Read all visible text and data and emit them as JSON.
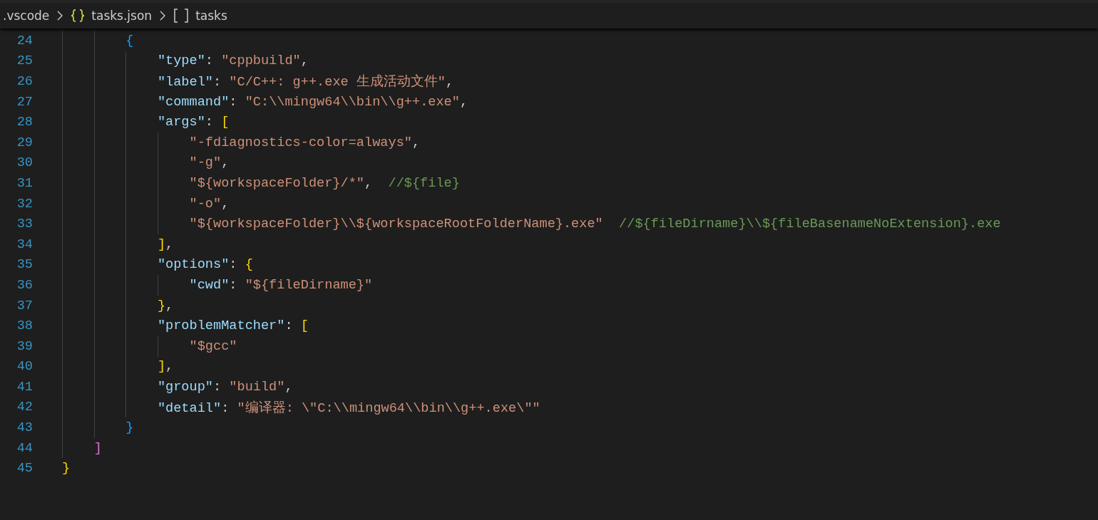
{
  "breadcrumb": [
    {
      "kind": "folder",
      "label": ".vscode"
    },
    {
      "kind": "json-file",
      "label": "tasks.json"
    },
    {
      "kind": "array",
      "label": "tasks"
    }
  ],
  "editor": {
    "lines": [
      {
        "number": "24",
        "tokens": [
          {
            "kind": "bracket_blue",
            "text": "        {"
          }
        ]
      },
      {
        "number": "25",
        "tokens": [
          {
            "kind": "key",
            "text": "            \"type\""
          },
          {
            "kind": "punct",
            "text": ": "
          },
          {
            "kind": "string",
            "text": "\"cppbuild\""
          },
          {
            "kind": "punct",
            "text": ","
          }
        ]
      },
      {
        "number": "26",
        "tokens": [
          {
            "kind": "key",
            "text": "            \"label\""
          },
          {
            "kind": "punct",
            "text": ": "
          },
          {
            "kind": "string",
            "text": "\"C/C++: g++.exe 生成活动文件\""
          },
          {
            "kind": "punct",
            "text": ","
          }
        ]
      },
      {
        "number": "27",
        "tokens": [
          {
            "kind": "key",
            "text": "            \"command\""
          },
          {
            "kind": "punct",
            "text": ": "
          },
          {
            "kind": "string",
            "text": "\"C:\\\\mingw64\\\\bin\\\\g++.exe\""
          },
          {
            "kind": "punct",
            "text": ","
          }
        ]
      },
      {
        "number": "28",
        "tokens": [
          {
            "kind": "key",
            "text": "            \"args\""
          },
          {
            "kind": "punct",
            "text": ": "
          },
          {
            "kind": "bracket_gold",
            "text": "["
          }
        ]
      },
      {
        "number": "29",
        "tokens": [
          {
            "kind": "string",
            "text": "                \"-fdiagnostics-color=always\""
          },
          {
            "kind": "punct",
            "text": ","
          }
        ]
      },
      {
        "number": "30",
        "tokens": [
          {
            "kind": "string",
            "text": "                \"-g\""
          },
          {
            "kind": "punct",
            "text": ","
          }
        ]
      },
      {
        "number": "31",
        "tokens": [
          {
            "kind": "string",
            "text": "                \"${workspaceFolder}/*\""
          },
          {
            "kind": "punct",
            "text": ",  "
          },
          {
            "kind": "comment",
            "text": "//${file}"
          }
        ]
      },
      {
        "number": "32",
        "tokens": [
          {
            "kind": "string",
            "text": "                \"-o\""
          },
          {
            "kind": "punct",
            "text": ","
          }
        ]
      },
      {
        "number": "33",
        "tokens": [
          {
            "kind": "string",
            "text": "                \"${workspaceFolder}\\\\${workspaceRootFolderName}.exe\"  "
          },
          {
            "kind": "comment",
            "text": "//${fileDirname}\\\\${fileBasenameNoExtension}.exe"
          }
        ]
      },
      {
        "number": "34",
        "tokens": [
          {
            "kind": "bracket_gold",
            "text": "            ]"
          },
          {
            "kind": "punct",
            "text": ","
          }
        ]
      },
      {
        "number": "35",
        "tokens": [
          {
            "kind": "key",
            "text": "            \"options\""
          },
          {
            "kind": "punct",
            "text": ": "
          },
          {
            "kind": "bracket_gold",
            "text": "{"
          }
        ]
      },
      {
        "number": "36",
        "tokens": [
          {
            "kind": "key",
            "text": "                \"cwd\""
          },
          {
            "kind": "punct",
            "text": ": "
          },
          {
            "kind": "string",
            "text": "\"${fileDirname}\""
          }
        ]
      },
      {
        "number": "37",
        "tokens": [
          {
            "kind": "bracket_gold",
            "text": "            }"
          },
          {
            "kind": "punct",
            "text": ","
          }
        ]
      },
      {
        "number": "38",
        "tokens": [
          {
            "kind": "key",
            "text": "            \"problemMatcher\""
          },
          {
            "kind": "punct",
            "text": ": "
          },
          {
            "kind": "bracket_gold",
            "text": "["
          }
        ]
      },
      {
        "number": "39",
        "tokens": [
          {
            "kind": "string",
            "text": "                \"$gcc\""
          }
        ]
      },
      {
        "number": "40",
        "tokens": [
          {
            "kind": "bracket_gold",
            "text": "            ]"
          },
          {
            "kind": "punct",
            "text": ","
          }
        ]
      },
      {
        "number": "41",
        "tokens": [
          {
            "kind": "key",
            "text": "            \"group\""
          },
          {
            "kind": "punct",
            "text": ": "
          },
          {
            "kind": "string",
            "text": "\"build\""
          },
          {
            "kind": "punct",
            "text": ","
          }
        ]
      },
      {
        "number": "42",
        "tokens": [
          {
            "kind": "key",
            "text": "            \"detail\""
          },
          {
            "kind": "punct",
            "text": ": "
          },
          {
            "kind": "string",
            "text": "\"编译器: \\\"C:\\\\mingw64\\\\bin\\\\g++.exe\\\"\""
          }
        ]
      },
      {
        "number": "43",
        "tokens": [
          {
            "kind": "bracket_blue",
            "text": "        }"
          }
        ]
      },
      {
        "number": "44",
        "tokens": [
          {
            "kind": "bracket_orchid",
            "text": "    ]"
          }
        ]
      },
      {
        "number": "45",
        "tokens": [
          {
            "kind": "bracket_gold",
            "text": "}"
          }
        ]
      }
    ]
  }
}
